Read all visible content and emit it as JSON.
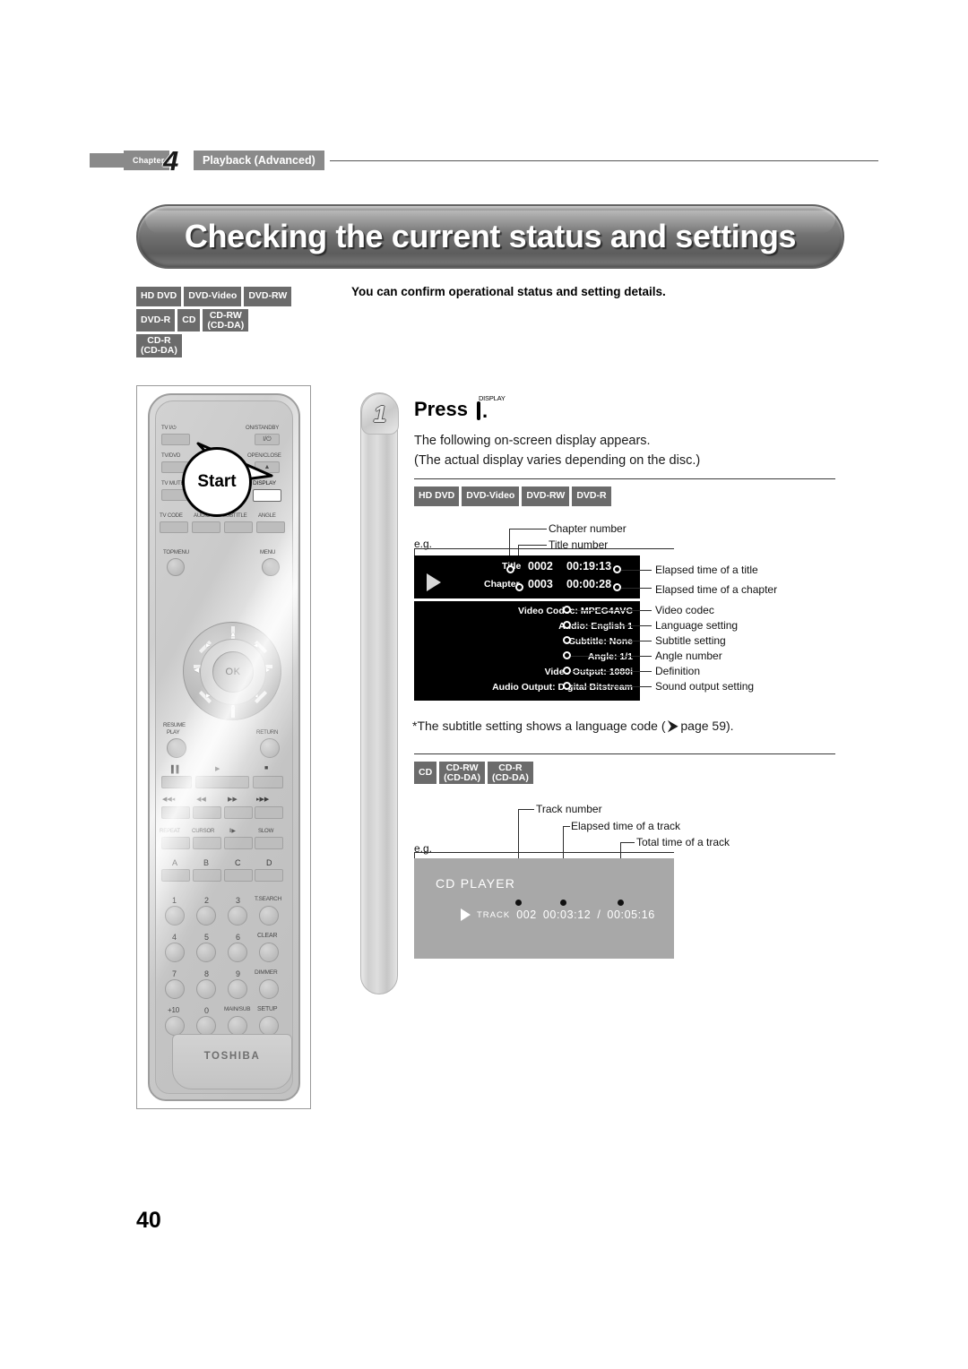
{
  "header": {
    "chapter_word": "Chapter",
    "chapter_number": "4",
    "chapter_title": "Playback (Advanced)"
  },
  "page_title": "Checking the current status and settings",
  "page_number": "40",
  "disc_badges_main": [
    [
      "HD DVD",
      "DVD-Video",
      "DVD-RW"
    ],
    [
      "DVD-R",
      "CD",
      "CD-RW\n(CD-DA)"
    ],
    [
      "CD-R\n(CD-DA)"
    ]
  ],
  "intro_text": "You can confirm operational status and setting details.",
  "step": {
    "number": "1",
    "press_word": "Press",
    "key_label": "DISPLAY",
    "period": ".",
    "line1": "The following on-screen display appears.",
    "line2": "(The actual display varies depending on the disc.)"
  },
  "remote": {
    "brand": "TOSHIBA",
    "callout": "Start",
    "labels": {
      "tv_power": "TV I/⏻",
      "on_standby": "ON/STANDBY",
      "on_standby_sym": "I/⏻",
      "tv_dvd": "TV/DVD",
      "open_close": "OPEN/CLOSE",
      "tv_mute": "TV MUTE",
      "display": "DISPLAY",
      "tv_code": "TV CODE",
      "audio": "AUDIO",
      "subtitle": "SUBTITLE",
      "angle": "ANGLE",
      "top_menu": "TOPMENU",
      "menu": "MENU",
      "ok": "OK",
      "resume_play_1": "RESUME",
      "resume_play_2": "PLAY",
      "return": "RETURN",
      "pause": "‖",
      "play": "▶",
      "stop": "■",
      "skip_prev": "⏮",
      "rew": "◀◀",
      "ff": "▶▶",
      "skip_next": "⏭",
      "repeat": "REPEAT",
      "cursor": "CURSOR",
      "step": "‖▶",
      "slow": "SLOW",
      "a": "A",
      "b": "B",
      "c": "C",
      "d": "D",
      "n1": "1",
      "n2": "2",
      "n3": "3",
      "t_search": "T.SEARCH",
      "n4": "4",
      "n5": "5",
      "n6": "6",
      "clear": "CLEAR",
      "n7": "7",
      "n8": "8",
      "n9": "9",
      "dimmer": "DIMMER",
      "plus10": "+10",
      "n0": "0",
      "main_sub": "MAIN/SUB",
      "setup": "SETUP"
    }
  },
  "dvd_section": {
    "badges": [
      "HD DVD",
      "DVD-Video",
      "DVD-RW",
      "DVD-R"
    ],
    "eg": "e.g.",
    "callouts_top": [
      "Chapter number",
      "Title number"
    ],
    "osd": {
      "title_label": "Title",
      "title_value": "0002",
      "title_time": "00:19:13",
      "chapter_label": "Chapter",
      "chapter_value": "0003",
      "chapter_time": "00:00:28",
      "rows": [
        "Video Codec: MPEG4AVC",
        "Audio: English 1",
        "Subtitle: None",
        "Angle: 1/1",
        "Video Output: 1080i",
        "Audio Output: Digital Bitstream"
      ]
    },
    "callouts_right": [
      "Elapsed time of a title",
      "Elapsed time of a chapter",
      "Video codec",
      "Language setting",
      "Subtitle setting",
      "Angle number",
      "Definition",
      "Sound output setting"
    ]
  },
  "note": {
    "prefix": "*The subtitle setting shows a language code (",
    "arrow": "⮞",
    "suffix": " page 59)."
  },
  "cd_section": {
    "badges": [
      "CD",
      "CD-RW\n(CD-DA)",
      "CD-R\n(CD-DA)"
    ],
    "eg": "e.g.",
    "callouts": [
      "Track number",
      "Elapsed time of a track",
      "Total time of a track"
    ],
    "display": {
      "heading": "CD PLAYER",
      "track_word": "TRACK",
      "track_number": "002",
      "elapsed": "00:03:12",
      "separator": "/",
      "total": "00:05:16"
    }
  },
  "colors": {
    "badge_gray": "#6b6b6b",
    "banner_gray": "#6e6e6e",
    "osd_black": "#000000",
    "cd_screen_gray": "#a8a8a8"
  }
}
